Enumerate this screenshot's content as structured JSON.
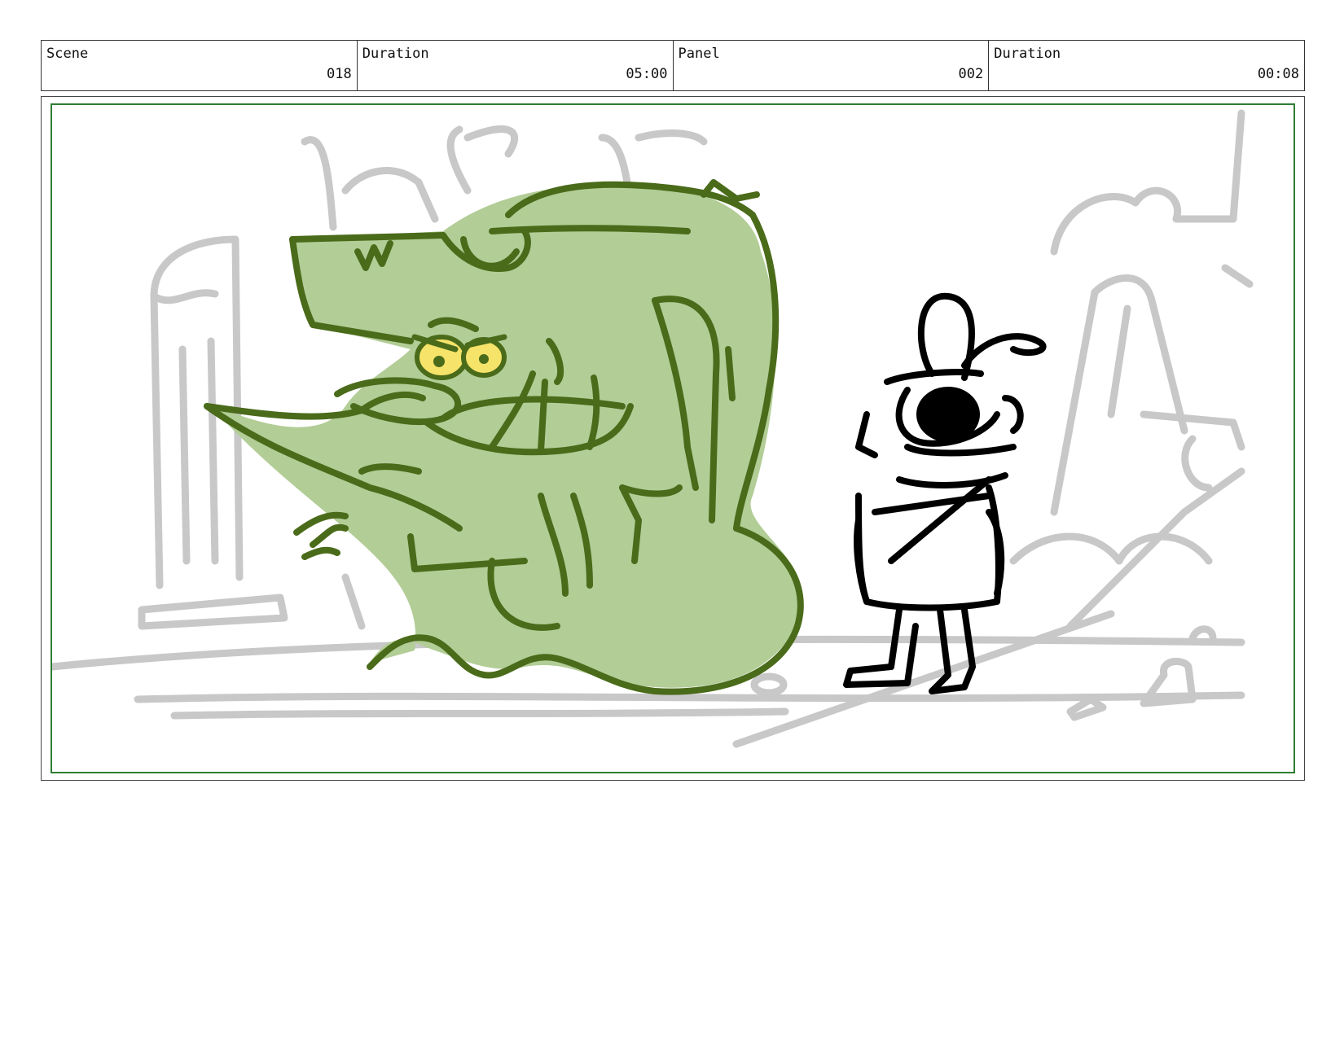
{
  "header": {
    "cells": [
      {
        "label": "Scene",
        "value": "018"
      },
      {
        "label": "Duration",
        "value": "05:00"
      },
      {
        "label": "Panel",
        "value": "002"
      },
      {
        "label": "Duration",
        "value": "00:08"
      }
    ]
  },
  "panel": {
    "frame_color": "#2e7d32",
    "background_sketch_color": "#c8c8c8",
    "genie_fill_color": "#b2cd96",
    "genie_line_color": "#4a6b1a",
    "eye_color": "#f6e36a",
    "character_line_color": "#000000"
  }
}
